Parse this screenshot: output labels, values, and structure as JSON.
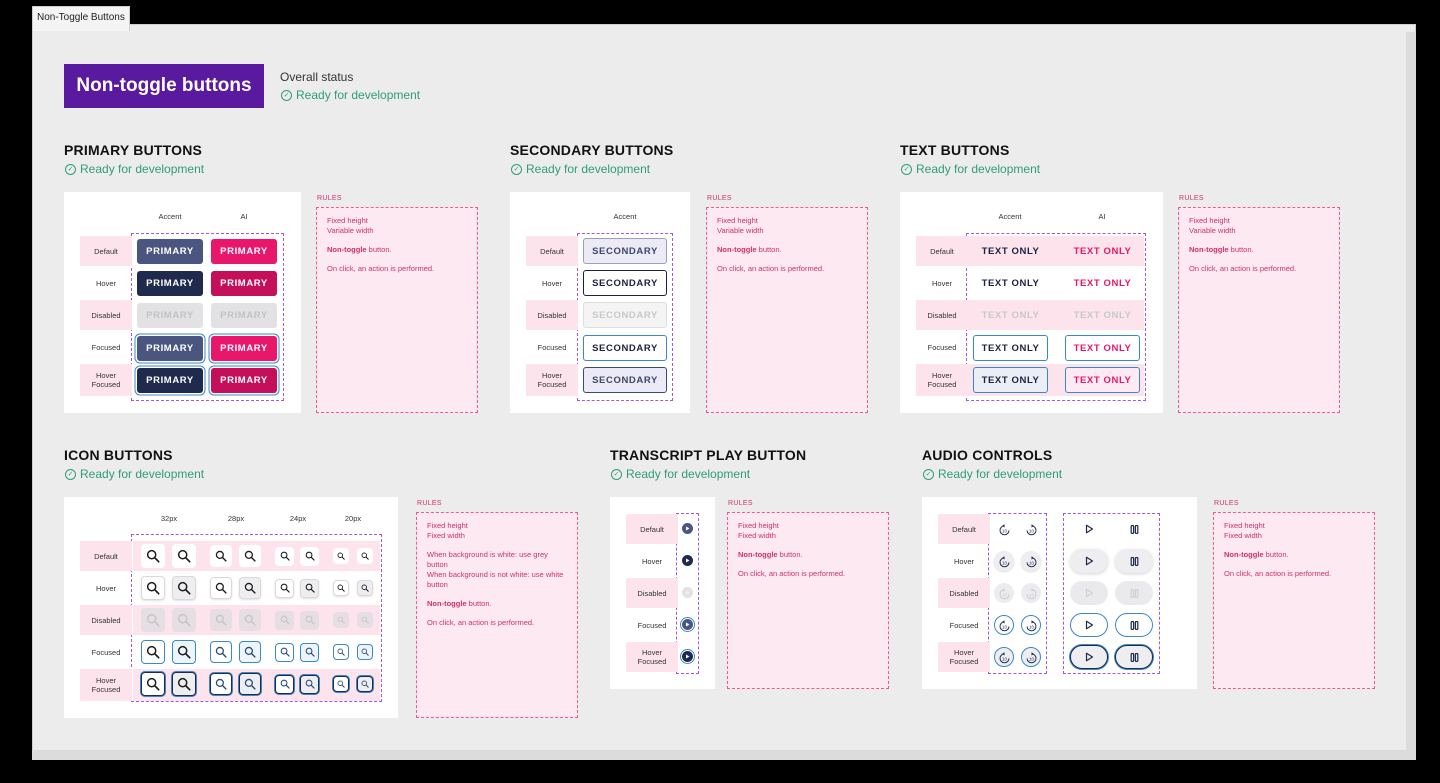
{
  "frame_tab": "Non-Toggle Buttons",
  "hero_title": "Non-toggle buttons",
  "overall": {
    "label": "Overall status",
    "status": "Ready for development"
  },
  "ready_text": "Ready for development",
  "rules_label": "RULES",
  "states": {
    "default": "Default",
    "hover": "Hover",
    "disabled": "Disabled",
    "focused": "Focused",
    "hover_focused_1": "Hover",
    "hover_focused_2": "Focused"
  },
  "columns": {
    "accent": "Accent",
    "ai": "AI"
  },
  "sections": {
    "primary": {
      "title": "PRIMARY BUTTONS",
      "label": "PRIMARY",
      "rules": {
        "line1": "Fixed height",
        "line2": "Variable width",
        "bold": "Non-toggle",
        "rest": " button.",
        "click": "On click, an action is performed."
      }
    },
    "secondary": {
      "title": "SECONDARY BUTTONS",
      "label": "SECONDARY",
      "rules": {
        "line1": "Fixed height",
        "line2": "Variable width",
        "bold": "Non-toggle",
        "rest": " button.",
        "click": "On click, an action is performed."
      }
    },
    "text": {
      "title": "TEXT BUTTONS",
      "label": "TEXT ONLY",
      "rules": {
        "line1": "Fixed height",
        "line2": "Variable width",
        "bold": "Non-toggle",
        "rest": " button.",
        "click": "On click, an action is performed."
      }
    },
    "icon": {
      "title": "ICON BUTTONS",
      "sizes": [
        "32px",
        "28px",
        "24px",
        "20px"
      ],
      "rules": {
        "line1": "Fixed height",
        "line2": "Fixed width",
        "bg1": "When background is white: use grey button",
        "bg2": "When background is not white: use white button",
        "bold": "Non-toggle",
        "rest": " button.",
        "click": "On click, an action is performed."
      }
    },
    "transcript": {
      "title": "TRANSCRIPT PLAY BUTTON",
      "rules": {
        "line1": "Fixed height",
        "line2": "Fixed width",
        "bold": "Non-toggle",
        "rest": " button.",
        "click": "On click, an action is performed."
      }
    },
    "audio": {
      "title": "AUDIO CONTROLS",
      "rules": {
        "line1": "Fixed height",
        "line2": "Fixed width",
        "bold": "Non-toggle",
        "rest": " button.",
        "click": "On click, an action is performed."
      }
    }
  },
  "icons": {
    "search": "search-icon",
    "play": "play-icon",
    "pause": "pause-icon",
    "rewind": "rewind-10-icon",
    "forward": "forward-10-icon",
    "check": "check-circle-icon"
  },
  "colors": {
    "hero": "#5a1aa0",
    "accent": "#4a5680",
    "accent_dark": "#1f2a4d",
    "ai": "#e8176c",
    "ready": "#2f9d78",
    "rules": "#d0306a",
    "focus": "#3a88c8"
  }
}
